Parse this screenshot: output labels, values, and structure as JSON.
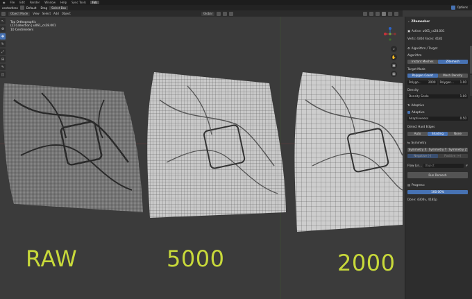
{
  "topbar": {
    "menus": [
      "File",
      "Edit",
      "Render",
      "Window",
      "Help",
      "Sync Tools"
    ],
    "active_tab": "Fab",
    "right_items": [
      "Options"
    ]
  },
  "header": {
    "editor_type": "contextless",
    "mode": "Object Mode",
    "menus": [
      "View",
      "Select",
      "Add",
      "Object"
    ],
    "orientation_label": "Global",
    "orientation_dd": "Default",
    "drag_label": "Drag",
    "select_box": "Select Box"
  },
  "viewport": {
    "overlay_lines": [
      "Top Orthographic",
      "(1) Collection | u061_cs28.001",
      "10 Centimeters"
    ],
    "labels": {
      "raw": "RAW",
      "five": "5000",
      "two": "2000"
    }
  },
  "panel": {
    "title": "ZRemesher",
    "active": "Active: u061_cs28.001",
    "verts_faces": "Verts: 4304  Faces: 4182",
    "algorithm_header": "Algorithm / Target",
    "algorithm_label": "Algorithm",
    "algo_options": [
      "Instant Meshes",
      "ZRemesh"
    ],
    "target_mode_label": "Target Mode",
    "target_options": [
      "Polygon Count",
      "Mesh Density"
    ],
    "polygon_label": "Polygo...",
    "polygon_value": "2000",
    "polygon2_label": "Polygon...",
    "polygon2_value": "1.00",
    "density_label": "Density",
    "density_scale_label": "Density Scale",
    "density_scale_value": "1.00",
    "adaptive_header": "Adaptive",
    "adaptive_label": "Adaptive",
    "adaptiveness_label": "Adaptiveness",
    "adaptiveness_value": "0.50",
    "hard_edges_label": "Detect Hard Edges",
    "hard_edges_options": [
      "Auto",
      "Shading",
      "None"
    ],
    "symmetry_header": "Symmetry",
    "symmetry_options": [
      "Symmetry X",
      "Symmetry Y",
      "Symmetry Z"
    ],
    "sym_row2": [
      "Negative (-)",
      "Positive (+)"
    ],
    "flow_label": "Flow Lin...",
    "flow_placeholder": "Object",
    "run_label": "Run Remesh",
    "progress_label": "Progress:",
    "progress_value_text": "100.00%",
    "progress_fraction": 1.0,
    "done_text": "Done: 4304v, 4182p",
    "accent": "#4772b3"
  }
}
